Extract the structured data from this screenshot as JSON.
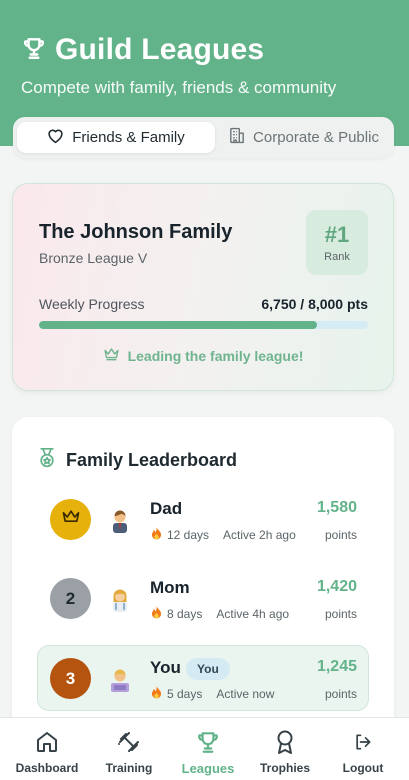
{
  "header": {
    "title": "Guild Leagues",
    "subtitle": "Compete with family, friends & community",
    "icon": "trophy-icon"
  },
  "tabs": [
    {
      "label": "Friends & Family",
      "icon": "heart-icon",
      "active": true
    },
    {
      "label": "Corporate & Public",
      "icon": "building-icon",
      "active": false
    }
  ],
  "hero": {
    "family_name": "The Johnson Family",
    "league": "Bronze League V",
    "rank": "#1",
    "rank_label": "Rank",
    "progress_label": "Weekly Progress",
    "progress_value": "6,750 / 8,000 pts",
    "progress_fraction": 0.84375,
    "leading_text": "Leading the family league!"
  },
  "leaderboard": {
    "title": "Family Leaderboard",
    "entries": [
      {
        "badge": "crown",
        "name": "Dad",
        "streak": "12 days",
        "activity": "Active 2h ago",
        "points": "1,580",
        "points_label": "points",
        "badge_color": "#e6b10b"
      },
      {
        "badge": "2",
        "name": "Mom",
        "streak": "8 days",
        "activity": "Active 4h ago",
        "points": "1,420",
        "points_label": "points",
        "badge_color": "#9aa0a6"
      },
      {
        "badge": "3",
        "name": "You",
        "tag": "You",
        "streak": "5 days",
        "activity": "Active now",
        "points": "1,245",
        "points_label": "points",
        "badge_color": "#b5540f"
      }
    ]
  },
  "nav": [
    {
      "label": "Dashboard",
      "icon": "home-icon"
    },
    {
      "label": "Training",
      "icon": "dumbbell-icon"
    },
    {
      "label": "Leagues",
      "icon": "trophy-icon",
      "active": true
    },
    {
      "label": "Trophies",
      "icon": "award-icon"
    },
    {
      "label": "Logout",
      "icon": "logout-icon"
    }
  ],
  "colors": {
    "accent": "#63b38a",
    "gold": "#e6b10b",
    "silver": "#9aa0a6",
    "bronze": "#b5540f"
  }
}
